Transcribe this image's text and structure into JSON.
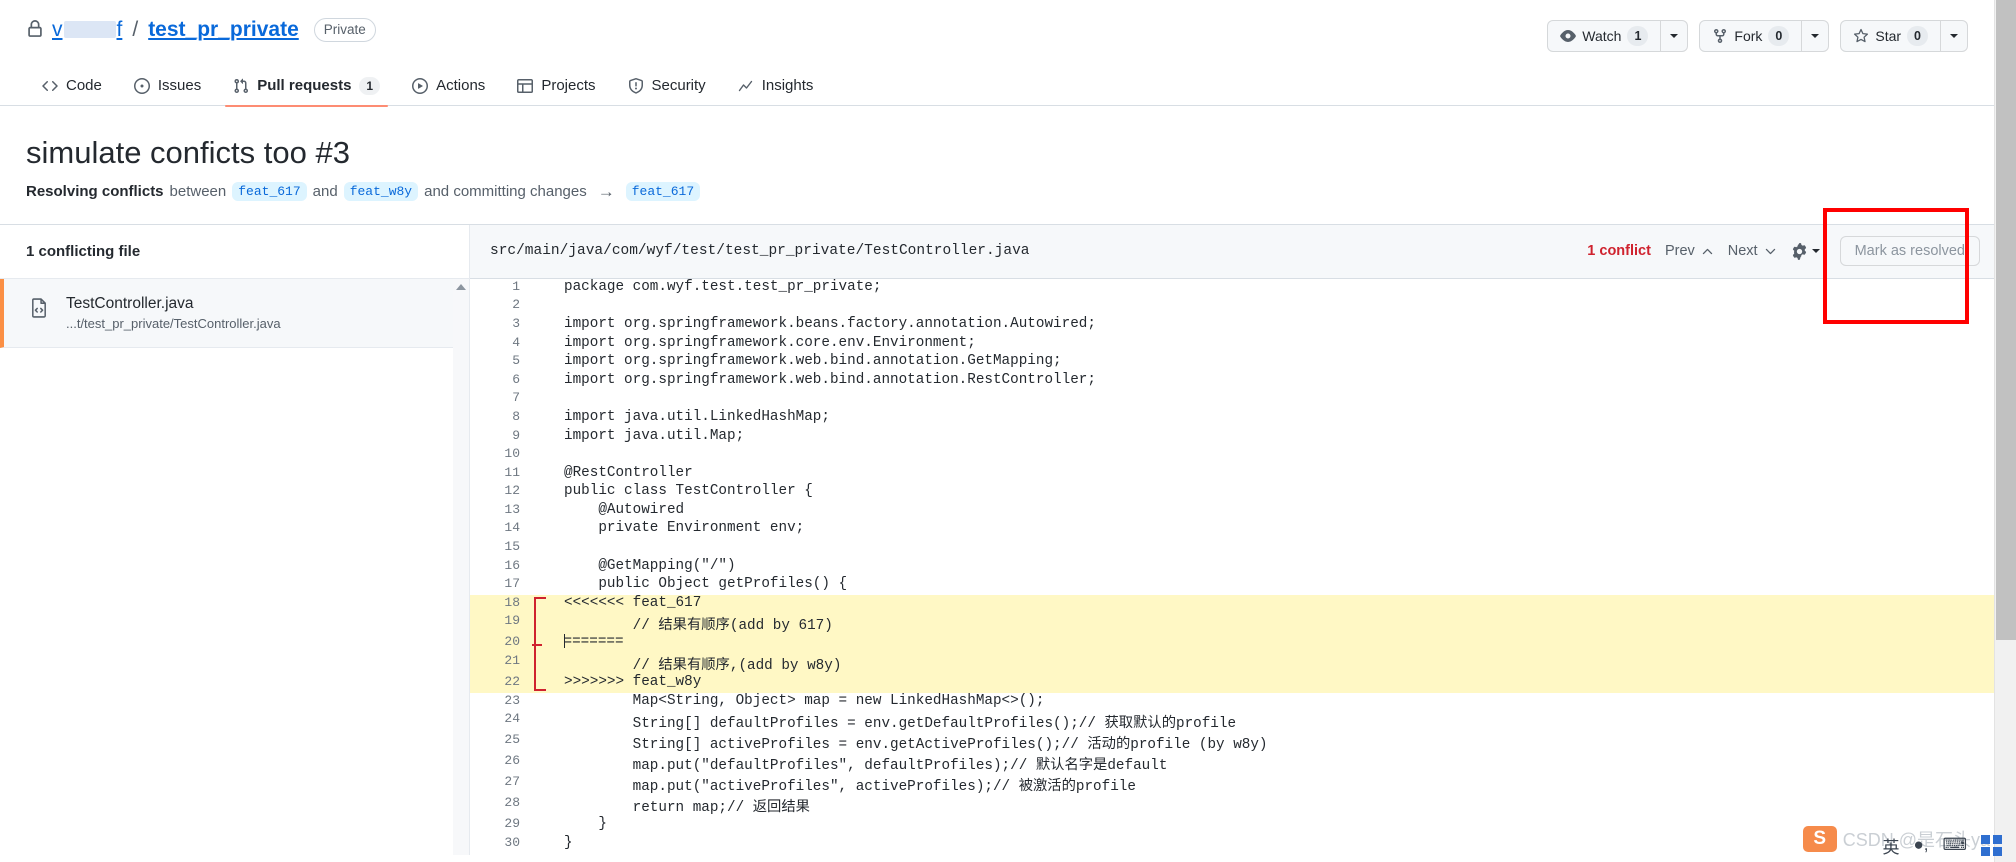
{
  "repo": {
    "visibility_icon": "lock-icon",
    "owner_prefix": "v",
    "owner_suffix": "f",
    "separator": "/",
    "name": "test_pr_private",
    "visibility_label": "Private"
  },
  "header_actions": [
    {
      "icon": "eye-icon",
      "label": "Watch",
      "count": "1",
      "has_caret": true
    },
    {
      "icon": "repo-forked-icon",
      "label": "Fork",
      "count": "0",
      "has_caret": true
    },
    {
      "icon": "star-icon",
      "label": "Star",
      "count": "0",
      "has_caret": true
    }
  ],
  "nav": {
    "items": [
      {
        "icon": "code-icon",
        "label": "Code",
        "count": null,
        "selected": false
      },
      {
        "icon": "issue-opened-icon",
        "label": "Issues",
        "count": null,
        "selected": false
      },
      {
        "icon": "git-pull-request-icon",
        "label": "Pull requests",
        "count": "1",
        "selected": true
      },
      {
        "icon": "play-icon",
        "label": "Actions",
        "count": null,
        "selected": false
      },
      {
        "icon": "table-icon",
        "label": "Projects",
        "count": null,
        "selected": false
      },
      {
        "icon": "shield-icon",
        "label": "Security",
        "count": null,
        "selected": false
      },
      {
        "icon": "graph-icon",
        "label": "Insights",
        "count": null,
        "selected": false
      }
    ]
  },
  "pull_request": {
    "title": "simulate conficts too #3",
    "subtitle": {
      "lead": "Resolving conflicts",
      "between": "between",
      "base_branch": "feat_617",
      "and": "and",
      "head_branch": "feat_w8y",
      "tail": "and committing changes",
      "arrow": "→",
      "target_branch": "feat_617"
    }
  },
  "sidebar": {
    "heading": "1 conflicting file",
    "files": [
      {
        "icon": "file-code-icon",
        "name": "TestController.java",
        "path": "...t/test_pr_private/TestController.java"
      }
    ]
  },
  "editor": {
    "file_path": "src/main/java/com/wyf/test/test_pr_private/TestController.java",
    "conflict_count_label": "1 conflict",
    "prev_label": "Prev",
    "next_label": "Next",
    "settings_icon": "gear-icon",
    "mark_resolved_label": "Mark as resolved",
    "mark_resolved_disabled": true,
    "accent_conflict_color": "#cf222e",
    "conflict_highlight_color": "#fff8c5",
    "lines": [
      {
        "n": "1",
        "text": "package com.wyf.test.test_pr_private;",
        "conflict": false
      },
      {
        "n": "2",
        "text": "",
        "conflict": false
      },
      {
        "n": "3",
        "text": "import org.springframework.beans.factory.annotation.Autowired;",
        "conflict": false
      },
      {
        "n": "4",
        "text": "import org.springframework.core.env.Environment;",
        "conflict": false
      },
      {
        "n": "5",
        "text": "import org.springframework.web.bind.annotation.GetMapping;",
        "conflict": false
      },
      {
        "n": "6",
        "text": "import org.springframework.web.bind.annotation.RestController;",
        "conflict": false
      },
      {
        "n": "7",
        "text": "",
        "conflict": false
      },
      {
        "n": "8",
        "text": "import java.util.LinkedHashMap;",
        "conflict": false
      },
      {
        "n": "9",
        "text": "import java.util.Map;",
        "conflict": false
      },
      {
        "n": "10",
        "text": "",
        "conflict": false
      },
      {
        "n": "11",
        "text": "@RestController",
        "conflict": false
      },
      {
        "n": "12",
        "text": "public class TestController {",
        "conflict": false
      },
      {
        "n": "13",
        "text": "    @Autowired",
        "conflict": false
      },
      {
        "n": "14",
        "text": "    private Environment env;",
        "conflict": false
      },
      {
        "n": "15",
        "text": "",
        "conflict": false
      },
      {
        "n": "16",
        "text": "    @GetMapping(\"/\")",
        "conflict": false
      },
      {
        "n": "17",
        "text": "    public Object getProfiles() {",
        "conflict": false
      },
      {
        "n": "18",
        "text": "<<<<<<< feat_617",
        "conflict": true
      },
      {
        "n": "19",
        "text": "        // 结果有顺序(add by 617)",
        "conflict": true
      },
      {
        "n": "20",
        "text": "=======",
        "conflict": true,
        "cursor": true
      },
      {
        "n": "21",
        "text": "        // 结果有顺序,(add by w8y)",
        "conflict": true
      },
      {
        "n": "22",
        "text": ">>>>>>> feat_w8y",
        "conflict": true
      },
      {
        "n": "23",
        "text": "        Map<String, Object> map = new LinkedHashMap<>();",
        "conflict": false
      },
      {
        "n": "24",
        "text": "        String[] defaultProfiles = env.getDefaultProfiles();// 获取默认的profile",
        "conflict": false
      },
      {
        "n": "25",
        "text": "        String[] activeProfiles = env.getActiveProfiles();// 活动的profile (by w8y)",
        "conflict": false
      },
      {
        "n": "26",
        "text": "        map.put(\"defaultProfiles\", defaultProfiles);// 默认名字是default",
        "conflict": false
      },
      {
        "n": "27",
        "text": "        map.put(\"activeProfiles\", activeProfiles);// 被激活的profile",
        "conflict": false
      },
      {
        "n": "28",
        "text": "        return map;// 返回结果",
        "conflict": false
      },
      {
        "n": "29",
        "text": "    }",
        "conflict": false
      },
      {
        "n": "30",
        "text": "}",
        "conflict": false
      }
    ]
  },
  "annotation": {
    "color": "#ff0000",
    "target": "mark-as-resolved-button"
  },
  "watermark": {
    "text": "CSDN @是石头ya",
    "ime_logo": "S",
    "ime_items": [
      "英",
      "●,",
      "⌨"
    ]
  }
}
